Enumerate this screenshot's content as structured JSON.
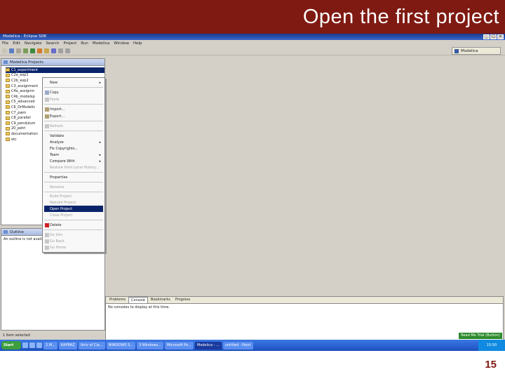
{
  "slide": {
    "title": "Open the first project",
    "page_number": "15",
    "accent_color": "#7f1a12"
  },
  "window": {
    "title": "Modelica - Eclipse SDK"
  },
  "menubar": [
    "File",
    "Edit",
    "Navigate",
    "Search",
    "Project",
    "Run",
    "Modelica",
    "Window",
    "Help"
  ],
  "perspective": {
    "label": "Modelica"
  },
  "explorer": {
    "tab": "Modelica Projects",
    "items": [
      "C1_experiment",
      "C2a_exp1",
      "C2b_exp2",
      "C3_assignment",
      "C4a_assignm",
      "C4b_modelsp",
      "C5_advanced",
      "C6_DrModelic",
      "C7_pwm",
      "C8_parallel",
      "C9_pendulum",
      "20_petri",
      "documentation",
      "etc"
    ]
  },
  "context_menu": [
    {
      "label": "New",
      "sub": true
    },
    {
      "label": "Copy"
    },
    {
      "label": "Paste",
      "disabled": true
    },
    {
      "label": "Import..."
    },
    {
      "label": "Export..."
    },
    {
      "label": "Refresh",
      "disabled": true
    },
    {
      "label": "Validate"
    },
    {
      "label": "Analyze",
      "sub": true
    },
    {
      "label": "Fix Copyrights..."
    },
    {
      "label": "Team",
      "sub": true
    },
    {
      "label": "Compare With",
      "sub": true
    },
    {
      "label": "Restore from Local History...",
      "disabled": true
    },
    {
      "label": "Properties"
    },
    {
      "label": "Rename",
      "disabled": true
    },
    {
      "label": "Build Project",
      "disabled": true
    },
    {
      "label": "Rebuild Project",
      "disabled": true
    },
    {
      "label": "Open Project",
      "highlighted": true
    },
    {
      "label": "Close Project",
      "disabled": true
    },
    {
      "label": "Delete"
    },
    {
      "label": "Go Into",
      "disabled": true
    },
    {
      "label": "Go Back",
      "disabled": true
    },
    {
      "label": "Go Home",
      "disabled": true
    }
  ],
  "outline": {
    "tab": "Outline",
    "message": "An outline is not available."
  },
  "console": {
    "tabs": [
      "Problems",
      "Console",
      "Bookmarks",
      "Progress"
    ],
    "message": "No consoles to display at this time."
  },
  "status": {
    "text": "1 item selected",
    "trial": "Read Me Trial (Button)"
  },
  "taskbar": {
    "start": "Start",
    "buttons": [
      "2 M...",
      "KAPRAZ",
      "Univ of Cla...",
      "WINDOWS S...",
      "3 Windows...",
      "Microsoft Po...",
      "Modelica - ...",
      "untitled - Paint"
    ],
    "clock": "15:50"
  }
}
